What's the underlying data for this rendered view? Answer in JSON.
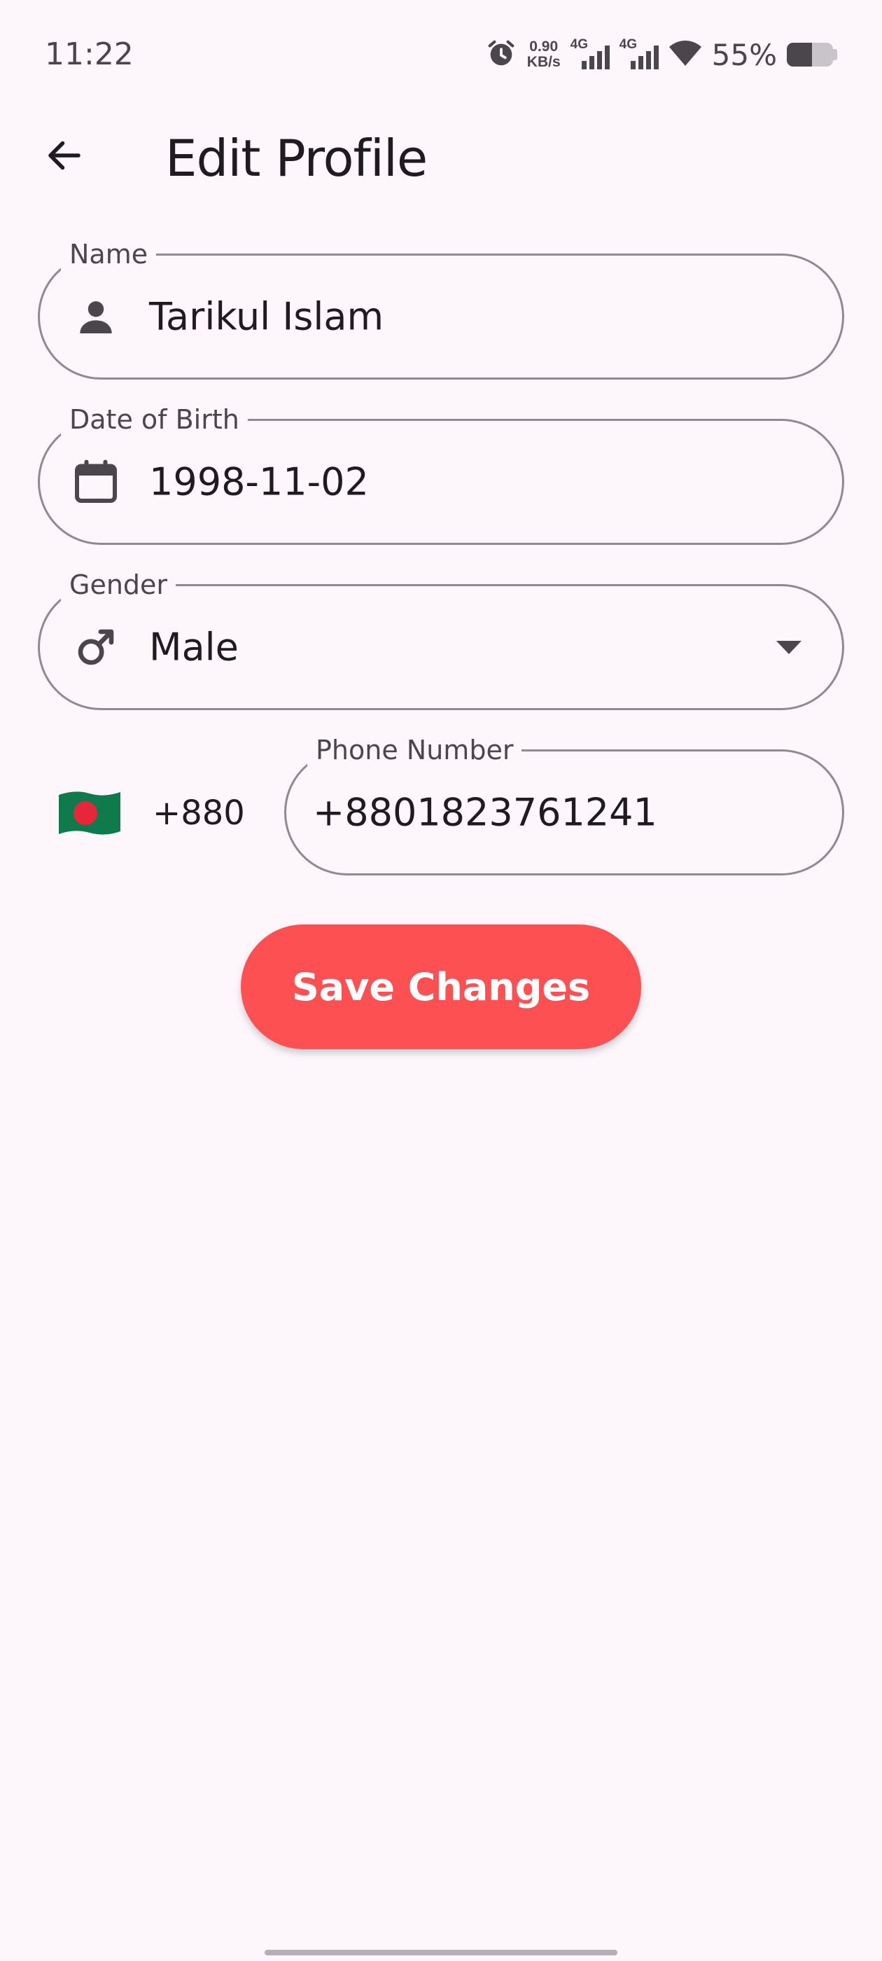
{
  "status_bar": {
    "time": "11:22",
    "net_speed_value": "0.90",
    "net_speed_unit": "KB/s",
    "sim1_type": "4G",
    "sim2_type": "4G",
    "battery_percent": "55%",
    "battery_level": 0.55,
    "icons": [
      "alarm-icon",
      "signal-icon",
      "signal-icon",
      "wifi-icon",
      "battery-icon"
    ]
  },
  "app_bar": {
    "title": "Edit Profile",
    "back_icon": "arrow-left-icon"
  },
  "form": {
    "name": {
      "label": "Name",
      "value": "Tarikul Islam",
      "icon": "person-icon"
    },
    "dob": {
      "label": "Date of Birth",
      "value": "1998-11-02",
      "icon": "calendar-icon"
    },
    "gender": {
      "label": "Gender",
      "value": "Male",
      "icon": "male-icon"
    },
    "phone": {
      "label": "Phone Number",
      "value": "+8801823761241",
      "country_flag": "bangladesh-flag-icon",
      "dial_code": "+880"
    }
  },
  "actions": {
    "save_label": "Save Changes"
  },
  "colors": {
    "background": "#fdf7fc",
    "accent": "#fd5052",
    "outline": "#8f8a90",
    "text": "#1f1b20"
  }
}
